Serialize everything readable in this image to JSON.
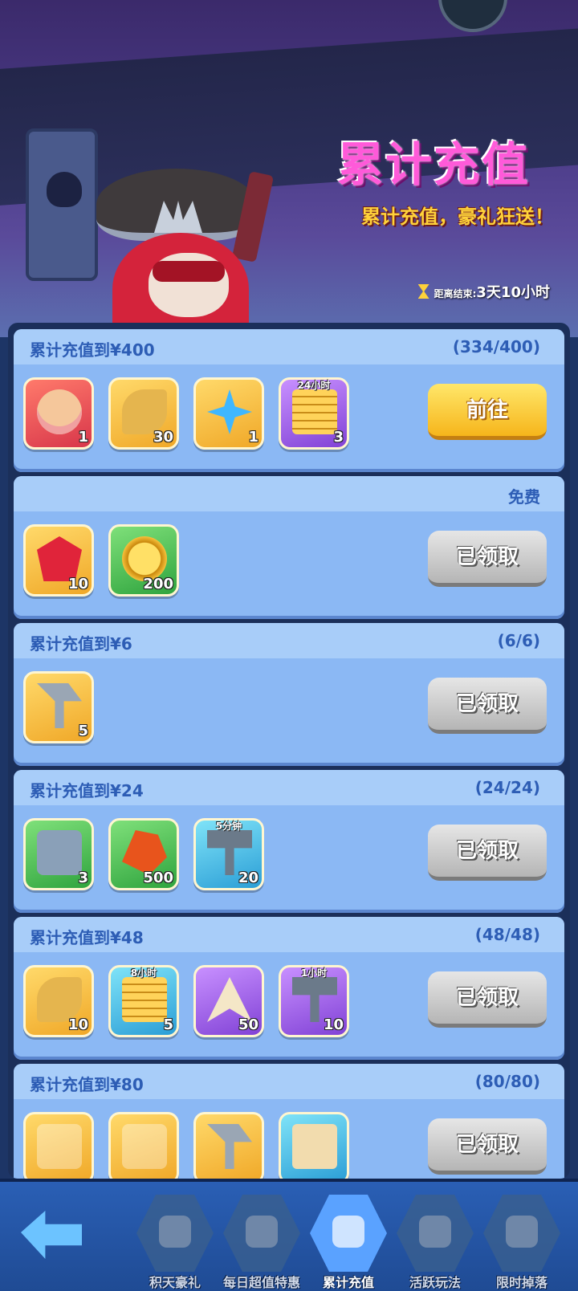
{
  "banner": {
    "title": "累计充值",
    "subtitle": "累计充值，豪礼狂送！",
    "countdown_label": "距离结束:",
    "countdown_value": "3天10小时"
  },
  "cards": [
    {
      "title": "累计充值到¥400",
      "progress": "(334/400)",
      "button": "前往",
      "button_state": "go",
      "items": [
        {
          "icon": "character-portrait-icon",
          "color": "red",
          "glyph": "g-face",
          "qty": "1",
          "tag": ""
        },
        {
          "icon": "golden-horn-icon",
          "color": "gold",
          "glyph": "g-horn",
          "qty": "30",
          "tag": ""
        },
        {
          "icon": "blue-star-crystal-icon",
          "color": "gold",
          "glyph": "g-star",
          "qty": "1",
          "tag": ""
        },
        {
          "icon": "gold-coin-stack-timer-icon",
          "color": "purple",
          "glyph": "g-stack",
          "qty": "3",
          "tag": "24小时"
        }
      ]
    },
    {
      "title": "",
      "progress": "免费",
      "button": "已领取",
      "button_state": "done",
      "items": [
        {
          "icon": "red-gem-icon",
          "color": "gold",
          "glyph": "g-gem",
          "qty": "10",
          "tag": ""
        },
        {
          "icon": "gold-coin-icon",
          "color": "green",
          "glyph": "g-coin",
          "qty": "200",
          "tag": ""
        }
      ]
    },
    {
      "title": "累计充值到¥6",
      "progress": "(6/6)",
      "button": "已领取",
      "button_state": "done",
      "items": [
        {
          "icon": "horn-trumpet-icon",
          "color": "gold",
          "glyph": "g-axe",
          "qty": "5",
          "tag": ""
        }
      ]
    },
    {
      "title": "累计充值到¥24",
      "progress": "(24/24)",
      "button": "已领取",
      "button_state": "done",
      "items": [
        {
          "icon": "mystery-chest-icon",
          "color": "green",
          "glyph": "g-chest",
          "qty": "3",
          "tag": ""
        },
        {
          "icon": "orange-crystal-icon",
          "color": "green",
          "glyph": "g-crystal",
          "qty": "500",
          "tag": ""
        },
        {
          "icon": "hammer-speedup-icon",
          "color": "blue",
          "glyph": "g-hammer",
          "qty": "20",
          "tag": "5分钟"
        }
      ]
    },
    {
      "title": "累计充值到¥48",
      "progress": "(48/48)",
      "button": "已领取",
      "button_state": "done",
      "items": [
        {
          "icon": "golden-horn-icon",
          "color": "gold",
          "glyph": "g-horn",
          "qty": "10",
          "tag": ""
        },
        {
          "icon": "gold-coin-stack-timer-icon",
          "color": "blue",
          "glyph": "g-stack",
          "qty": "5",
          "tag": "8小时"
        },
        {
          "icon": "plane-badge-icon",
          "color": "purple",
          "glyph": "g-plane",
          "qty": "50",
          "tag": ""
        },
        {
          "icon": "hammer-speedup-icon",
          "color": "purple",
          "glyph": "g-hammer",
          "qty": "10",
          "tag": "1小时"
        }
      ]
    },
    {
      "title": "累计充值到¥80",
      "progress": "(80/80)",
      "button": "已领取",
      "button_state": "done",
      "items": [
        {
          "icon": "skull-book-icon",
          "color": "gold",
          "glyph": "g-blank",
          "qty": "",
          "tag": ""
        },
        {
          "icon": "armor-icon",
          "color": "gold",
          "glyph": "g-blank",
          "qty": "",
          "tag": ""
        },
        {
          "icon": "horn-trumpet-icon",
          "color": "gold",
          "glyph": "g-axe",
          "qty": "",
          "tag": ""
        },
        {
          "icon": "scroll-map-icon",
          "color": "blue",
          "glyph": "g-scroll",
          "qty": "",
          "tag": ""
        }
      ]
    }
  ],
  "nav": {
    "back_icon": "back-arrow-icon",
    "tabs": [
      {
        "label": "积天豪礼",
        "icon": "coin-bag-icon",
        "active": false
      },
      {
        "label": "每日超值特惠",
        "icon": "star-gift-icon",
        "active": false
      },
      {
        "label": "累计充值",
        "icon": "coin-bag-icon",
        "active": true
      },
      {
        "label": "活跃玩法",
        "icon": "compass-icon",
        "active": false
      },
      {
        "label": "限时掉落",
        "icon": "gift-box-icon",
        "active": false
      }
    ]
  },
  "colors": {
    "title_pink": "#ff5ad9",
    "subtitle_yellow": "#ffd23a",
    "card_header_text": "#2d5db5",
    "go_button": "#f6b51b",
    "claimed_button": "#b5b5b5"
  }
}
